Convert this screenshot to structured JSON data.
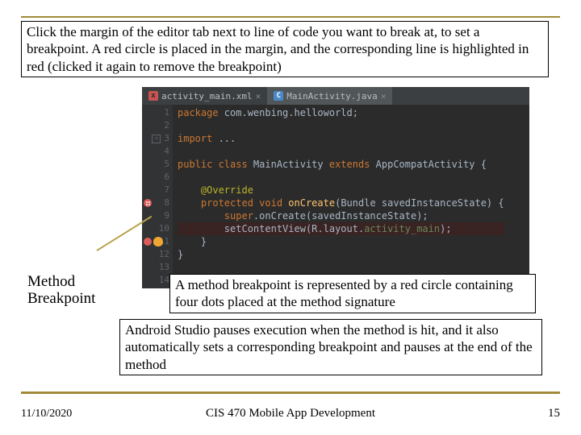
{
  "intro_text": "Click the margin of the editor tab next to line of code you want to break at, to set a breakpoint. A red circle is placed in the margin, and the corresponding line is highlighted in red (clicked it again to remove the breakpoint)",
  "tabs": [
    {
      "label": "activity_main.xml"
    },
    {
      "label": "MainActivity.java"
    }
  ],
  "code": {
    "gutter": [
      "1",
      "2",
      "3",
      "4",
      "5",
      "6",
      "7",
      "8",
      "9",
      "10",
      "11",
      "12",
      "13",
      "14"
    ],
    "lines": {
      "l1_kw": "package",
      "l1_rest": " com.wenbing.helloworld;",
      "l3_kw": "import",
      "l3_rest": " ...",
      "l5_kw1": "public class",
      "l5_cls": " MainActivity",
      "l5_kw2": " extends",
      "l5_sup": " AppCompatActivity",
      "l5_end": " {",
      "l7_ann": "@Override",
      "l8_kw": "protected void",
      "l8_mth": " onCreate",
      "l8_sig": "(Bundle savedInstanceState) {",
      "l9_kw": "super",
      "l9_rest": ".onCreate(savedInstanceState);",
      "l10_call": "setContentView(R.layout.",
      "l10_id": "activity_main",
      "l10_end": ");",
      "l11": "    }",
      "l12": "}"
    }
  },
  "callout_label": "Method\nBreakpoint",
  "desc_text": "A method breakpoint is represented by a red circle containing four dots placed at the method signature",
  "para_text": "Android Studio pauses execution when the method is hit, and it also automatically sets a corresponding breakpoint and pauses at the end of the method",
  "footer": {
    "date": "11/10/2020",
    "course": "CIS 470 Mobile App Development",
    "page": "15"
  }
}
